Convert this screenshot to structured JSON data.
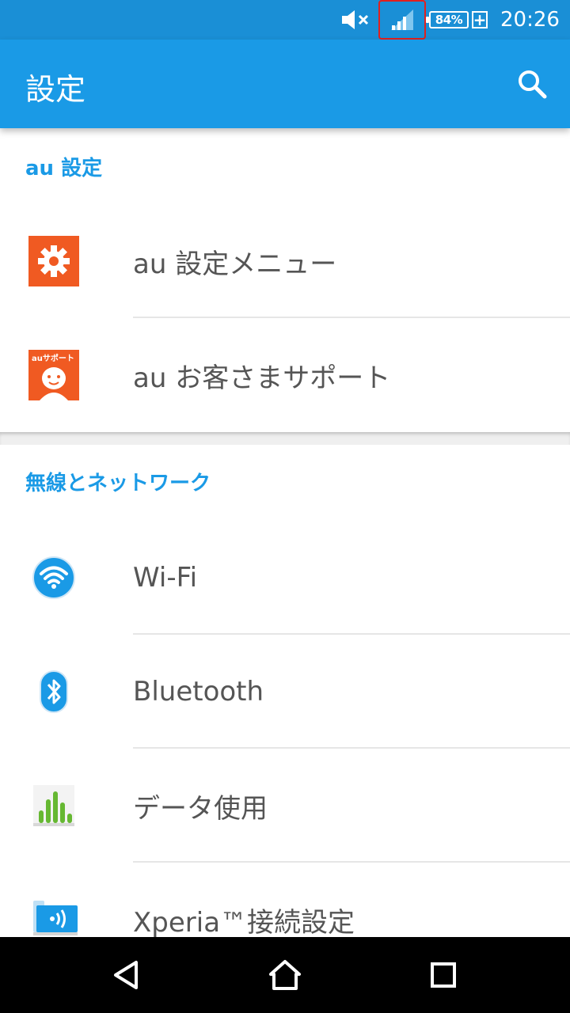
{
  "status_bar": {
    "battery_percent": "84%",
    "battery_plus": "+",
    "time": "20:26",
    "icons": [
      "volume-mute-icon",
      "signal-icon",
      "battery-icon"
    ]
  },
  "app_bar": {
    "title": "設定",
    "search_icon": "search-icon"
  },
  "sections": [
    {
      "header": "au 設定",
      "items": [
        {
          "label": "au 設定メニュー",
          "icon": "gear-icon"
        },
        {
          "label": "au お客さまサポート",
          "icon": "au-support-icon",
          "icon_text": "auサポート"
        }
      ]
    },
    {
      "header": "無線とネットワーク",
      "items": [
        {
          "label": "Wi-Fi",
          "icon": "wifi-icon"
        },
        {
          "label": "Bluetooth",
          "icon": "bluetooth-icon"
        },
        {
          "label": "データ使用",
          "icon": "data-usage-icon"
        },
        {
          "label": "Xperia™接続設定",
          "icon": "xperia-connect-icon"
        }
      ]
    }
  ],
  "nav_bar": {
    "icons": [
      "back-icon",
      "home-icon",
      "recents-icon"
    ]
  },
  "colors": {
    "status_bar": "#1a8fd6",
    "app_bar": "#1a9ae6",
    "accent": "#1a9ae6",
    "au_orange": "#f05a22"
  }
}
